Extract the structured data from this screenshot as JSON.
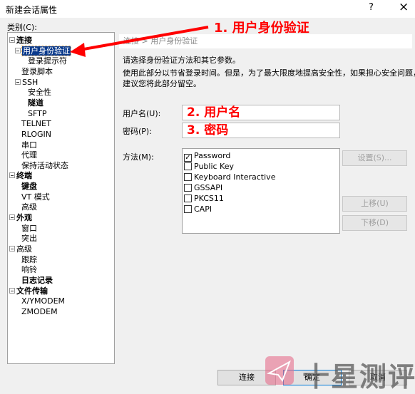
{
  "window": {
    "title": "新建会话属性",
    "help": "?",
    "close": "×"
  },
  "category_label": "类别(C):",
  "tree": [
    {
      "label": "连接",
      "level": 0,
      "expand": true,
      "bold": true
    },
    {
      "label": "用户身份验证",
      "level": 1,
      "expand": true,
      "selected": true
    },
    {
      "label": "登录提示符",
      "level": 2
    },
    {
      "label": "登录脚本",
      "level": 1
    },
    {
      "label": "SSH",
      "level": 1,
      "expand": true
    },
    {
      "label": "安全性",
      "level": 2
    },
    {
      "label": "隧道",
      "level": 2,
      "bold": true
    },
    {
      "label": "SFTP",
      "level": 2
    },
    {
      "label": "TELNET",
      "level": 1
    },
    {
      "label": "RLOGIN",
      "level": 1
    },
    {
      "label": "串口",
      "level": 1
    },
    {
      "label": "代理",
      "level": 1
    },
    {
      "label": "保持活动状态",
      "level": 1
    },
    {
      "label": "终端",
      "level": 0,
      "expand": true,
      "bold": true
    },
    {
      "label": "键盘",
      "level": 1,
      "bold": true
    },
    {
      "label": "VT 模式",
      "level": 1
    },
    {
      "label": "高级",
      "level": 1
    },
    {
      "label": "外观",
      "level": 0,
      "expand": true,
      "bold": true
    },
    {
      "label": "窗口",
      "level": 1
    },
    {
      "label": "突出",
      "level": 1
    },
    {
      "label": "高级",
      "level": 0,
      "expand": true
    },
    {
      "label": "跟踪",
      "level": 1
    },
    {
      "label": "响铃",
      "level": 1
    },
    {
      "label": "日志记录",
      "level": 1,
      "bold": true
    },
    {
      "label": "文件传输",
      "level": 0,
      "expand": true,
      "bold": true
    },
    {
      "label": "X/YMODEM",
      "level": 1
    },
    {
      "label": "ZMODEM",
      "level": 1
    }
  ],
  "breadcrumb": "连接 > 用户身份验证",
  "desc1": "请选择身份验证方法和其它参数。",
  "desc2": "使用此部分以节省登录时间。但是，为了最大限度地提高安全性，如果担心安全问题，",
  "desc3": "建议您将此部分留空。",
  "username": {
    "label": "用户名(U):",
    "value": "2. 用户名"
  },
  "password": {
    "label": "密码(P):",
    "value": "3. 密码"
  },
  "method": {
    "label": "方法(M):",
    "items": [
      {
        "label": "Password",
        "checked": true
      },
      {
        "label": "Public Key",
        "checked": false
      },
      {
        "label": "Keyboard Interactive",
        "checked": false
      },
      {
        "label": "GSSAPI",
        "checked": false
      },
      {
        "label": "PKCS11",
        "checked": false
      },
      {
        "label": "CAPI",
        "checked": false
      }
    ]
  },
  "buttons": {
    "settings": "设置(S)...",
    "up": "上移(U)",
    "down": "下移(D)",
    "connect": "连接",
    "ok": "确定",
    "cancel": "取消"
  },
  "annotation": "1. 用户身份验证",
  "watermark": "十星测评",
  "colors": {
    "annotation": "#ff0000",
    "selection": "#0a3a8c"
  }
}
